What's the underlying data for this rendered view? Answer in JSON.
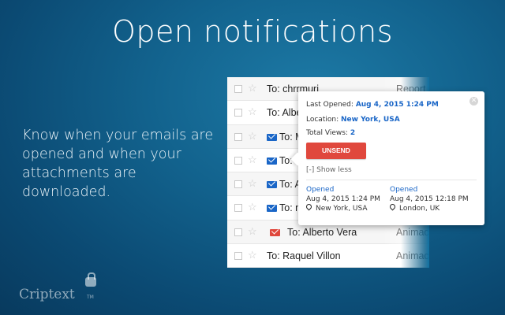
{
  "headline": "Open notifications",
  "tagline": "Know when your emails are opened and when your attachments are downloaded.",
  "logo": "Criptext",
  "logo_tm": "TM",
  "colors": {
    "accent_blue": "#1a66c7",
    "unsend_red": "#e0483d",
    "envelope_blue": "#1a66c7",
    "envelope_red": "#e0483d"
  },
  "inbox": {
    "rows": [
      {
        "to": "To: chrrmuri",
        "subject": "Report",
        "envelope": "none"
      },
      {
        "to": "To: Albe",
        "subject": "",
        "envelope": "none"
      },
      {
        "to": "To: M",
        "subject": "",
        "envelope": "blue"
      },
      {
        "to": "To: M",
        "subject": "",
        "envelope": "blue"
      },
      {
        "to": "To: A",
        "subject": "",
        "envelope": "blue"
      },
      {
        "to": "To: n",
        "subject": "",
        "envelope": "blue"
      },
      {
        "to": "To: Alberto Vera",
        "subject": "Animac",
        "envelope": "red"
      },
      {
        "to": "To: Raquel Villon",
        "subject": "Animac",
        "envelope": "none"
      }
    ]
  },
  "popup": {
    "last_opened_label": "Last Opened:",
    "last_opened_value": "Aug 4, 2015 1:24 PM",
    "location_label": "Location:",
    "location_value": "New York, USA",
    "total_views_label": "Total Views:",
    "total_views_value": "2",
    "unsend_label": "UNSEND",
    "show_less_label": "[-] Show less",
    "events": [
      {
        "status": "Opened",
        "datetime": "Aug 4, 2015 1:24 PM",
        "location": "New York, USA"
      },
      {
        "status": "Opened",
        "datetime": "Aug 4, 2015 12:18 PM",
        "location": "London, UK"
      }
    ]
  }
}
